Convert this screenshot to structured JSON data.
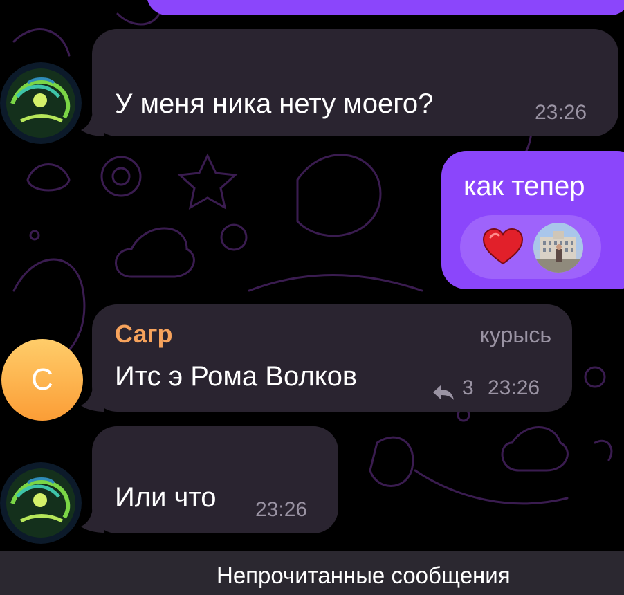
{
  "messages": [
    {
      "text": "У меня ника нету моего?",
      "time": "23:26"
    },
    {
      "text": "как тепер",
      "reactions": [
        "heart-reaction",
        "photo-reaction"
      ]
    },
    {
      "sender": "Сагр",
      "badge": "курысь",
      "text": "Итс э Рома Волков",
      "reply_count": "3",
      "time": "23:26",
      "avatar_letter": "С"
    },
    {
      "text": "Или что",
      "time": "23:26"
    }
  ],
  "unread_banner": "Непрочитанные сообщения",
  "colors": {
    "background": "#000000",
    "incoming_bubble": "#2a2430",
    "outgoing_bubble": "#8b46fb",
    "sender_name": "#f7a35c",
    "time_text": "#9a93a3",
    "heart": "#e1202a",
    "avatar_letter_bg": "#fb9d36"
  }
}
